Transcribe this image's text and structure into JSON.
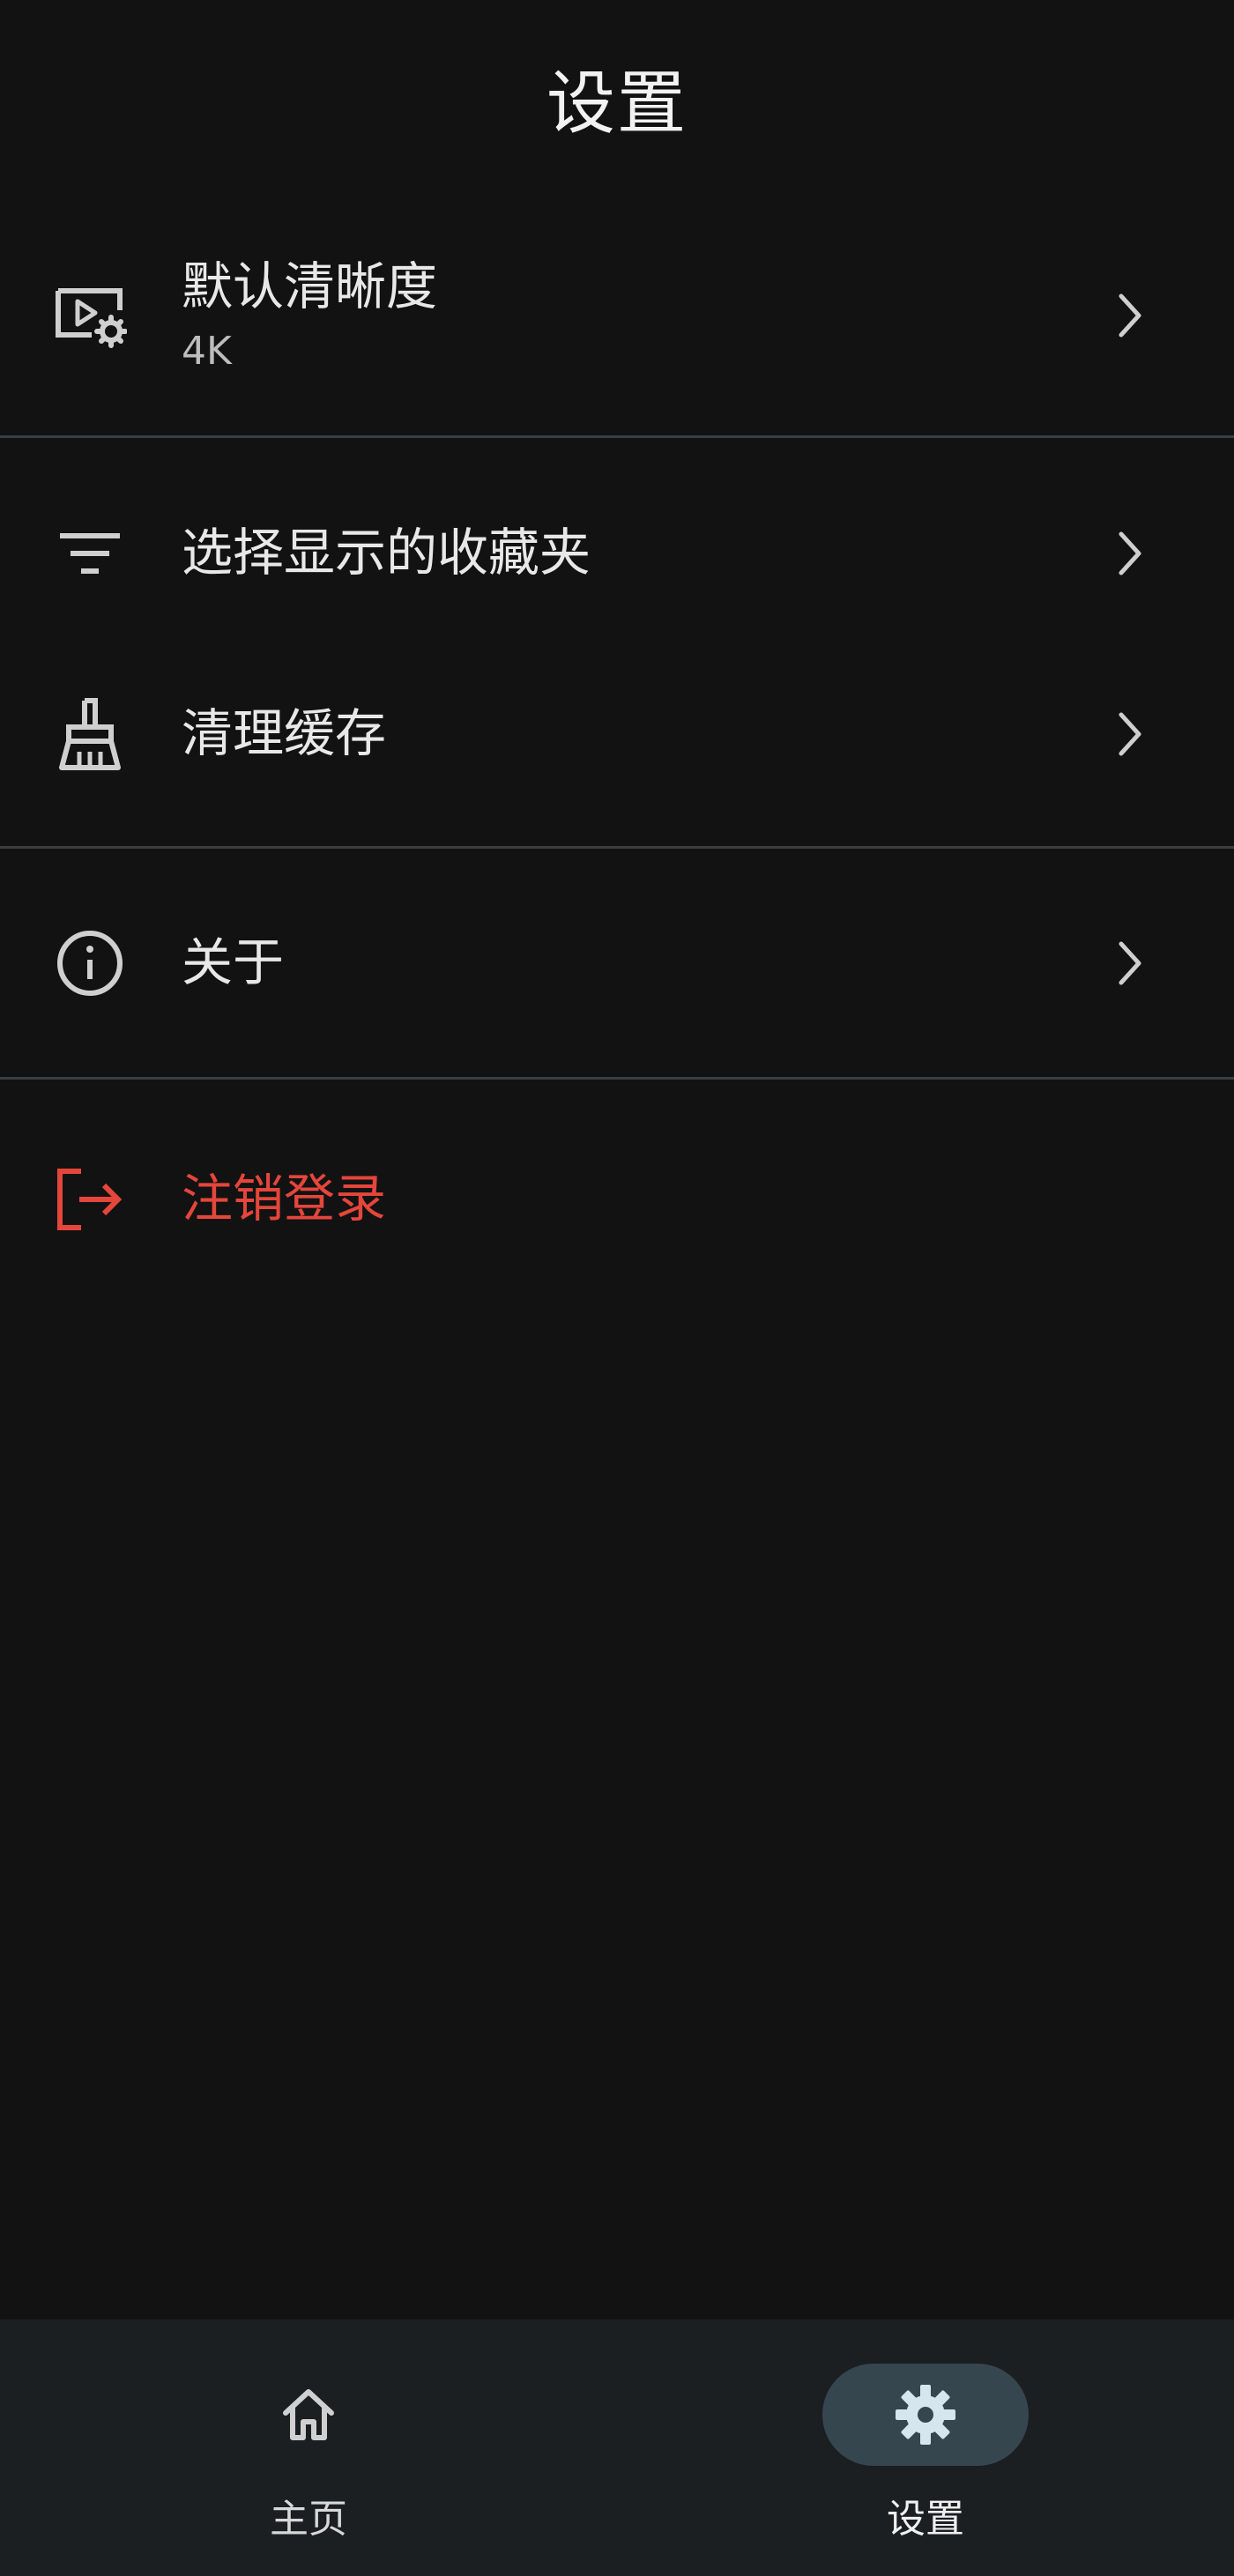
{
  "header": {
    "title": "设置"
  },
  "settings": {
    "default_quality": {
      "label": "默认清晰度",
      "value": "4K",
      "icon": "video-settings-icon"
    },
    "favorites": {
      "label": "选择显示的收藏夹",
      "icon": "filter-list-icon"
    },
    "clear_cache": {
      "label": "清理缓存",
      "icon": "broom-icon"
    },
    "about": {
      "label": "关于",
      "icon": "info-icon"
    },
    "logout": {
      "label": "注销登录",
      "icon": "logout-icon",
      "color": "#e5463b"
    }
  },
  "bottom_nav": {
    "home": {
      "label": "主页",
      "icon": "home-icon",
      "selected": false
    },
    "settings": {
      "label": "设置",
      "icon": "gear-icon",
      "selected": true
    }
  },
  "colors": {
    "background": "#121212",
    "divider": "#3c3d3e",
    "nav_background": "#1b1f22",
    "active_pill": "#36464f",
    "danger": "#e5463b"
  }
}
